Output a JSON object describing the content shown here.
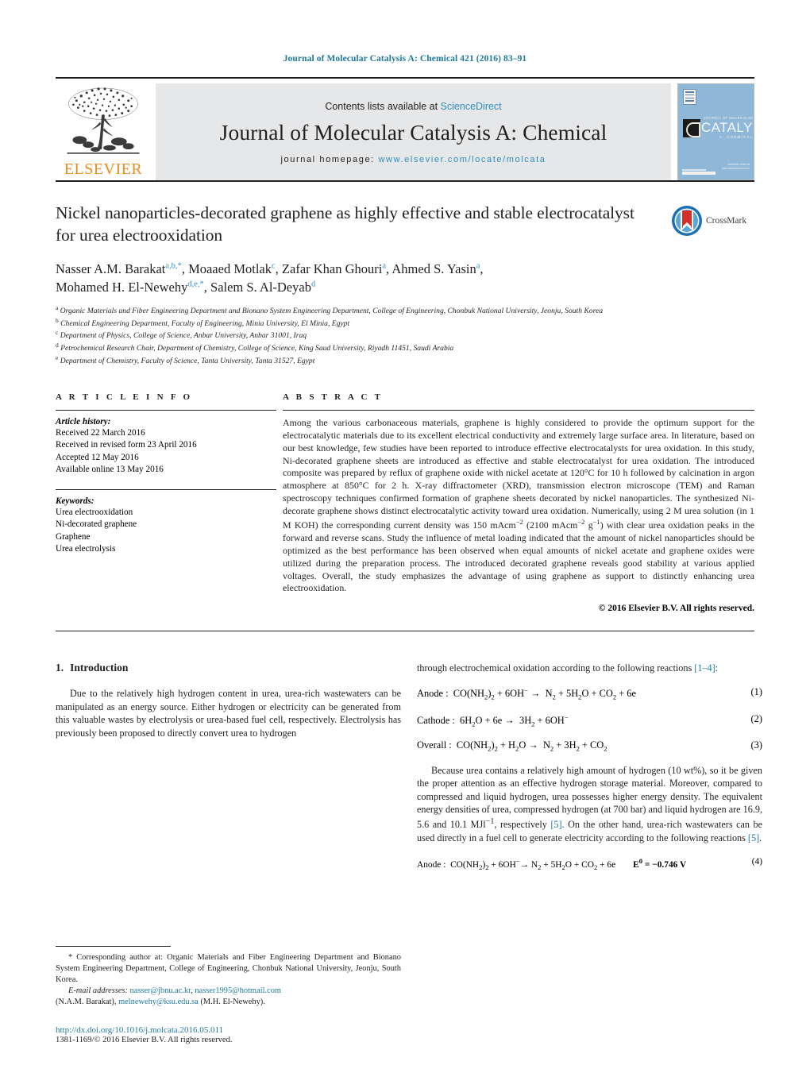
{
  "running_head": "Journal of Molecular Catalysis A: Chemical 421 (2016) 83–91",
  "banner": {
    "publisher_name": "ELSEVIER",
    "contents_prefix": "Contents lists available at ",
    "contents_link": "ScienceDirect",
    "journal_title": "Journal of Molecular Catalysis A: Chemical",
    "homepage_prefix": "journal homepage: ",
    "homepage_url": "www.elsevier.com/locate/molcata",
    "cover": {
      "line_small": "JOURNAL OF MOLECULAR",
      "line_big": "CATALYSIS",
      "line_sub": "A: CHEMICAL",
      "footer": "Available online at www.sciencedirect.com"
    }
  },
  "article": {
    "title": "Nickel nanoparticles-decorated graphene as highly effective and stable electrocatalyst for urea electrooxidation",
    "crossmark_label": "CrossMark",
    "authors_line1": "Nasser A.M. Barakat",
    "authors": [
      {
        "name": "Nasser A.M. Barakat",
        "marks": "a,b,*"
      },
      {
        "name": "Moaaed Motlak",
        "marks": "c"
      },
      {
        "name": "Zafar Khan Ghouri",
        "marks": "a"
      },
      {
        "name": "Ahmed S. Yasin",
        "marks": "a"
      },
      {
        "name": "Mohamed H. El-Newehy",
        "marks": "d,e,*"
      },
      {
        "name": "Salem S. Al-Deyab",
        "marks": "d"
      }
    ],
    "affiliations": [
      {
        "mark": "a",
        "text": "Organic Materials and Fiber Engineering Department and Bionano System Engineering Department, College of Engineering, Chonbuk National University, Jeonju, South Korea"
      },
      {
        "mark": "b",
        "text": "Chemical Engineering Department, Faculty of Engineering, Minia University, El Minia, Egypt"
      },
      {
        "mark": "c",
        "text": "Department of Physics, College of Science, Anbar University, Anbar 31001, Iraq"
      },
      {
        "mark": "d",
        "text": "Petrochemical Research Chair, Department of Chemistry, College of Science, King Saud University, Riyadh 11451, Saudi Arabia"
      },
      {
        "mark": "e",
        "text": "Department of Chemistry, Faculty of Science, Tanta University, Tanta 31527, Egypt"
      }
    ]
  },
  "article_info": {
    "heading": "A R T I C L E   I N F O",
    "history_label": "Article history:",
    "history": [
      "Received 22 March 2016",
      "Received in revised form 23 April 2016",
      "Accepted 12 May 2016",
      "Available online 13 May 2016"
    ],
    "keywords_label": "Keywords:",
    "keywords": [
      "Urea electrooxidation",
      "Ni-decorated graphene",
      "Graphene",
      "Urea electrolysis"
    ]
  },
  "abstract": {
    "heading": "A B S T R A C T",
    "paragraph_part1": "Among the various carbonaceous materials, graphene is highly considered to provide the optimum support for the electrocatalytic materials due to its excellent electrical conductivity and extremely large surface area. In literature, based on our best knowledge, few studies have been reported to introduce effective electrocatalysts for urea oxidation. In this study, Ni-decorated graphene sheets are introduced as effective and stable electrocatalyst for urea oxidation. The introduced composite was prepared by reflux of graphene oxide with nickel acetate at 120",
    "temp1": "°C for 10 h followed by calcination in argon atmosphere at 850",
    "temp2": "°C for 2 h. X-ray diffractometer (XRD), transmission electron microscope (TEM) and Raman spectroscopy techniques confirmed formation of graphene sheets decorated by nickel nanoparticles. The synthesized Ni-decorate graphene shows distinct electrocatalytic activity toward urea oxidation. Numerically, using 2 M urea solution (in 1 M KOH) the corresponding current density was 150 mAcm",
    "sup1": "−2",
    "mid1": " (2100 mAcm",
    "sup2": "−2",
    "mid2": " g",
    "sup3": "−1",
    "tail": ") with clear urea oxidation peaks in the forward and reverse scans. Study the influence of metal loading indicated that the amount of nickel nanoparticles should be optimized as the best performance has been observed when equal amounts of nickel acetate and graphene oxides were utilized during the preparation process. The introduced decorated graphene reveals good stability at various applied voltages. Overall, the study emphasizes the advantage of using graphene as support to distinctly enhancing urea electrooxidation.",
    "copyright": "© 2016 Elsevier B.V. All rights reserved."
  },
  "introduction": {
    "number": "1.",
    "title": "Introduction",
    "para1": "Due to the relatively high hydrogen content in urea, urea-rich wastewaters can be manipulated as an energy source. Either hydrogen or electricity can be generated from this valuable wastes by electrolysis or urea-based fuel cell, respectively. Electrolysis has previously been proposed to directly convert urea to hydrogen"
  },
  "right_column": {
    "para_cont_a": "through electrochemical oxidation according to the following reactions ",
    "ref_1_4": "[1–4]",
    "para_cont_b": ":",
    "equations": [
      {
        "label": "Anode :",
        "lhs_a": "CO(NH",
        "lhs_sub1": "2",
        "lhs_b": ")",
        "lhs_sub2": "2",
        "lhs_c": " + 6OH",
        "lhs_sup": "−",
        "arrow": "→",
        "rhs": "N",
        "rhs_sub1": "2",
        "rhs_b": " + 5H",
        "rhs_sub2": "2",
        "rhs_c": "O + CO",
        "rhs_sub3": "2",
        "rhs_d": " + 6e",
        "potential": "",
        "number": "(1)"
      },
      {
        "label": "Cathode :",
        "lhs_a": "6H",
        "lhs_sub1": "2",
        "lhs_b": "O + 6e",
        "arrow": "→",
        "rhs": "3H",
        "rhs_sub1": "2",
        "rhs_b": " + 6OH",
        "rhs_sup": "−",
        "potential": "",
        "number": "(2)"
      },
      {
        "label": "Overall :",
        "lhs_a": "CO(NH",
        "lhs_sub1": "2",
        "lhs_b": ")",
        "lhs_sub2": "2",
        "lhs_c": " + H",
        "lhs_sub3": "2",
        "lhs_d": "O",
        "arrow": "→",
        "rhs": "N",
        "rhs_sub1": "2",
        "rhs_b": " + 3H",
        "rhs_sub2": "2",
        "rhs_c": " + CO",
        "rhs_sub3": "2",
        "potential": "",
        "number": "(3)"
      }
    ],
    "para2_a": "Because urea contains a relatively high amount of hydrogen (10 wt%), so it be given the proper attention as an effective hydrogen storage material. Moreover, compared to compressed and liquid hydrogen, urea possesses higher energy density. The equivalent energy densities of urea, compressed hydrogen (at 700 bar) and liquid hydrogen are 16.9, 5.6 and 10.1 MJl",
    "para2_sup": "−1",
    "para2_b": ", respectively ",
    "ref_5a": "[5]",
    "para2_c": ". On the other hand, urea-rich wastewaters can be used directly in a fuel cell to generate electricity according to the following reactions ",
    "ref_5b": "[5]",
    "para2_d": ".",
    "eq4": {
      "label": "Anode :",
      "body": "CO(NH2)2 + 6OH− → N2 + 5H2O + CO2 + 6e",
      "potential_symbol": "E",
      "potential_sup": "0",
      "potential_value": "= −0.746 V",
      "number": "(4)"
    }
  },
  "footnotes": {
    "corresponding": "* Corresponding author at: Organic Materials and Fiber Engineering Department and Bionano System Engineering Department, College of Engineering, Chonbuk National University, Jeonju, South Korea.",
    "email_label": "E-mail addresses:",
    "email1": "nasser@jbnu.ac.kr",
    "email2": "nasser1995@hotmail.com",
    "email_name1": "(N.A.M. Barakat),",
    "email3": "melnewehy@ksu.edu.sa",
    "email_name2": "(M.H. El-Newehy).",
    "doi": "http://dx.doi.org/10.1016/j.molcata.2016.05.011",
    "issn": "1381-1169/© 2016 Elsevier B.V. All rights reserved."
  }
}
